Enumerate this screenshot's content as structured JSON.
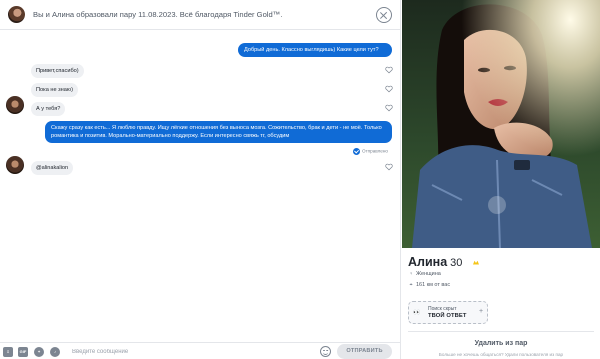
{
  "header": {
    "text": "Вы и Алина образовали пару 11.08.2023. Всё благодаря Tinder Gold™."
  },
  "messages": [
    {
      "dir": "out",
      "text": "Добрый день. Классно выглядишь) Какие цели тут?"
    },
    {
      "dir": "in",
      "text": "Привет,спасибо)"
    },
    {
      "dir": "in",
      "text": "Пока не знаю)"
    },
    {
      "dir": "in",
      "text": "А у тебя?"
    },
    {
      "dir": "out",
      "text": "Скажу сразу как есть... Я люблю правду. Ищу лёгкие отношения без выноса мозга. Сожительство, брак и дети - не моё. Только романтика и позитив. Морально-материально поддержу. Если интересно свяжь тг, обсудим"
    },
    {
      "dir": "in",
      "text": "@alinakalion"
    }
  ],
  "sent_status": "Отправлено",
  "input": {
    "placeholder": "Введите сообщение",
    "gif_label": "GIF",
    "send_label": "ОТПРАВИТЬ"
  },
  "profile": {
    "name": "Алина",
    "age": "30",
    "gender": "Женщина",
    "distance": "161 км от вас",
    "promo_small": "Поиск скрыт",
    "promo_big": "ТВОЙ ОТВЕТ",
    "unmatch_label": "Удалить из пар",
    "unmatch_sub": "Больше не хочешь общаться? Удали пользователя из пар"
  },
  "colors": {
    "accent": "#106bd6",
    "incoming_bubble": "#eef0f3",
    "gold_badge": "#f5c518"
  },
  "icons": [
    "close-icon",
    "heart-icon",
    "sent-check-icon",
    "gender-icon",
    "location-icon",
    "eyes-icon",
    "plus-icon",
    "attach-icon",
    "gif-icon",
    "sticker-icon",
    "music-icon",
    "emoji-icon",
    "gold-badge-icon"
  ]
}
